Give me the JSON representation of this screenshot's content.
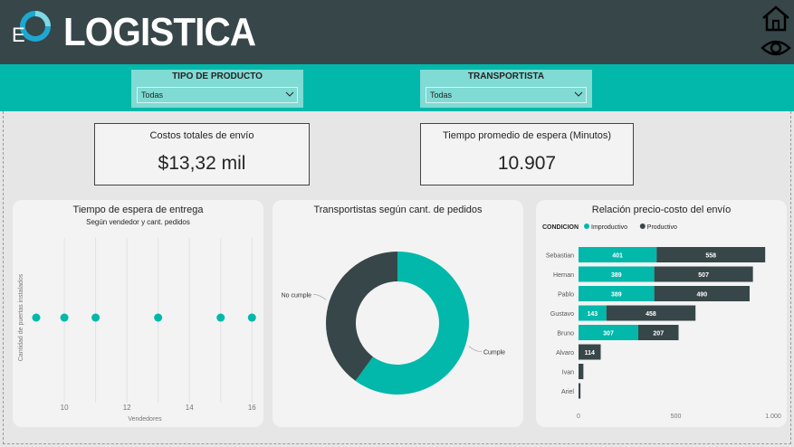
{
  "header": {
    "logo_letter": "E",
    "title": "LOGISTICA",
    "icons": [
      "home-icon",
      "eye-icon"
    ]
  },
  "filters": [
    {
      "title": "TIPO DE PRODUCTO",
      "value": "Todas"
    },
    {
      "title": "TRANSPORTISTA",
      "value": "Todas"
    }
  ],
  "kpis": [
    {
      "label": "Costos totales de envío",
      "value": "$13,32 mil"
    },
    {
      "label": "Tiempo promedio de espera (Minutos)",
      "value": "10.907"
    }
  ],
  "colors": {
    "header": "#374649",
    "accent": "#01b8aa",
    "dark": "#374649",
    "panel": "#f3f3f3"
  },
  "charts": {
    "scatter": {
      "title": "Tiempo de espera de entrega",
      "subtitle": "Según vendedor y cant. pedidos",
      "xlabel": "Vendedores",
      "ylabel": "Cantidad de puertas instalados"
    },
    "donut": {
      "title": "Transportistas según cant. de pedidos"
    },
    "bars": {
      "title": "Relación precio-costo del envío",
      "legend_title": "CONDICION"
    }
  },
  "chart_data": [
    {
      "type": "scatter",
      "title": "Tiempo de espera de entrega",
      "subtitle": "Según vendedor y cant. pedidos",
      "xlabel": "Vendedores",
      "ylabel": "Cantidad de puertas instalados",
      "xlim": [
        9.1,
        16.05
      ],
      "xticks": [
        10,
        12,
        14,
        16
      ],
      "x": [
        9.1,
        10,
        11,
        13,
        15,
        16
      ],
      "color": "#01b8aa",
      "grid": true
    },
    {
      "type": "pie",
      "title": "Transportistas según cant. de pedidos",
      "categories": [
        "Cumple",
        "No cumple"
      ],
      "values": [
        60,
        40
      ],
      "colors": [
        "#01b8aa",
        "#374649"
      ],
      "hole": true
    },
    {
      "type": "bar",
      "orientation": "horizontal",
      "stacked": true,
      "title": "Relación precio-costo del envío",
      "legend_title": "CONDICION",
      "legend_position": "top-left",
      "categories": [
        "Sebastian",
        "Hernan",
        "Pablo",
        "Gustavo",
        "Bruno",
        "Alvaro",
        "Ivan",
        "Ariel"
      ],
      "series": [
        {
          "name": "Improductivo",
          "color": "#01b8aa",
          "values": [
            401,
            389,
            389,
            143,
            307,
            0,
            0,
            0
          ]
        },
        {
          "name": "Productivo",
          "color": "#374649",
          "values": [
            558,
            507,
            490,
            458,
            207,
            114,
            25,
            10
          ]
        }
      ],
      "xticks": [
        "0",
        "500",
        "1.000"
      ],
      "xlim": [
        0,
        1000
      ]
    }
  ]
}
